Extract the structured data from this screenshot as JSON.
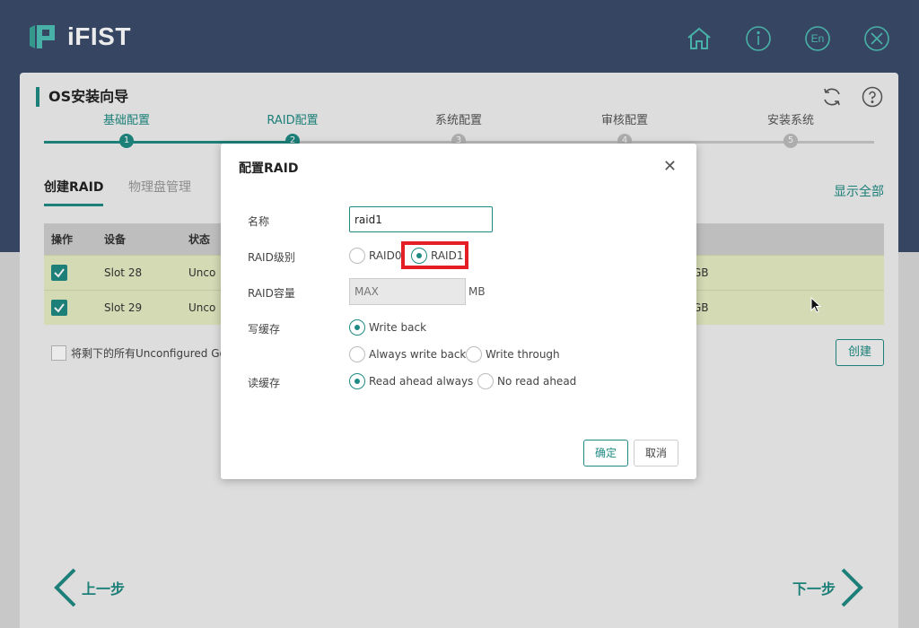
{
  "app": {
    "name": "iFIST",
    "header_icons": [
      "home-icon",
      "info-icon",
      "language-icon",
      "close-icon"
    ],
    "language_label": "En"
  },
  "page": {
    "title": "OS安装向导",
    "steps": [
      {
        "label": "基础配置",
        "number": "1"
      },
      {
        "label": "RAID配置",
        "number": "2"
      },
      {
        "label": "系统配置",
        "number": "3"
      },
      {
        "label": "审核配置",
        "number": "4"
      },
      {
        "label": "安装系统",
        "number": "5"
      }
    ],
    "active_step": 2,
    "subtabs": [
      "创建RAID",
      "物理盘管理"
    ],
    "show_all": "显示全部",
    "table": {
      "headers": [
        "操作",
        "设备",
        "状态"
      ],
      "rows": [
        {
          "device": "Slot 28",
          "status": "Unco",
          "size": "GB"
        },
        {
          "device": "Slot 29",
          "status": "Unco",
          "size": "GB"
        }
      ]
    },
    "select_remaining": "将剩下的所有Unconfigured Goo",
    "create_button": "创建",
    "prev": "上一步",
    "next": "下一步"
  },
  "dialog": {
    "title": "配置RAID",
    "name_label": "名称",
    "name_value": "raid1",
    "raid_level_label": "RAID级别",
    "raid_levels": [
      "RAID0",
      "RAID1"
    ],
    "raid_level_selected": "RAID1",
    "capacity_label": "RAID容量",
    "capacity_value": "MAX",
    "capacity_unit": "MB",
    "write_cache_label": "写缓存",
    "write_cache_options": [
      "Write back",
      "Always write back",
      "Write through"
    ],
    "write_cache_selected": "Write back",
    "read_cache_label": "读缓存",
    "read_cache_options": [
      "Read ahead always",
      "No read ahead"
    ],
    "read_cache_selected": "Read ahead always",
    "ok": "确定",
    "cancel": "取消"
  },
  "colors": {
    "header_bg": "#3b4d6b",
    "accent": "#1f8a83",
    "icon": "#4fc1b6",
    "row_highlight": "#e6edc4",
    "annotation": "#e51e25"
  }
}
